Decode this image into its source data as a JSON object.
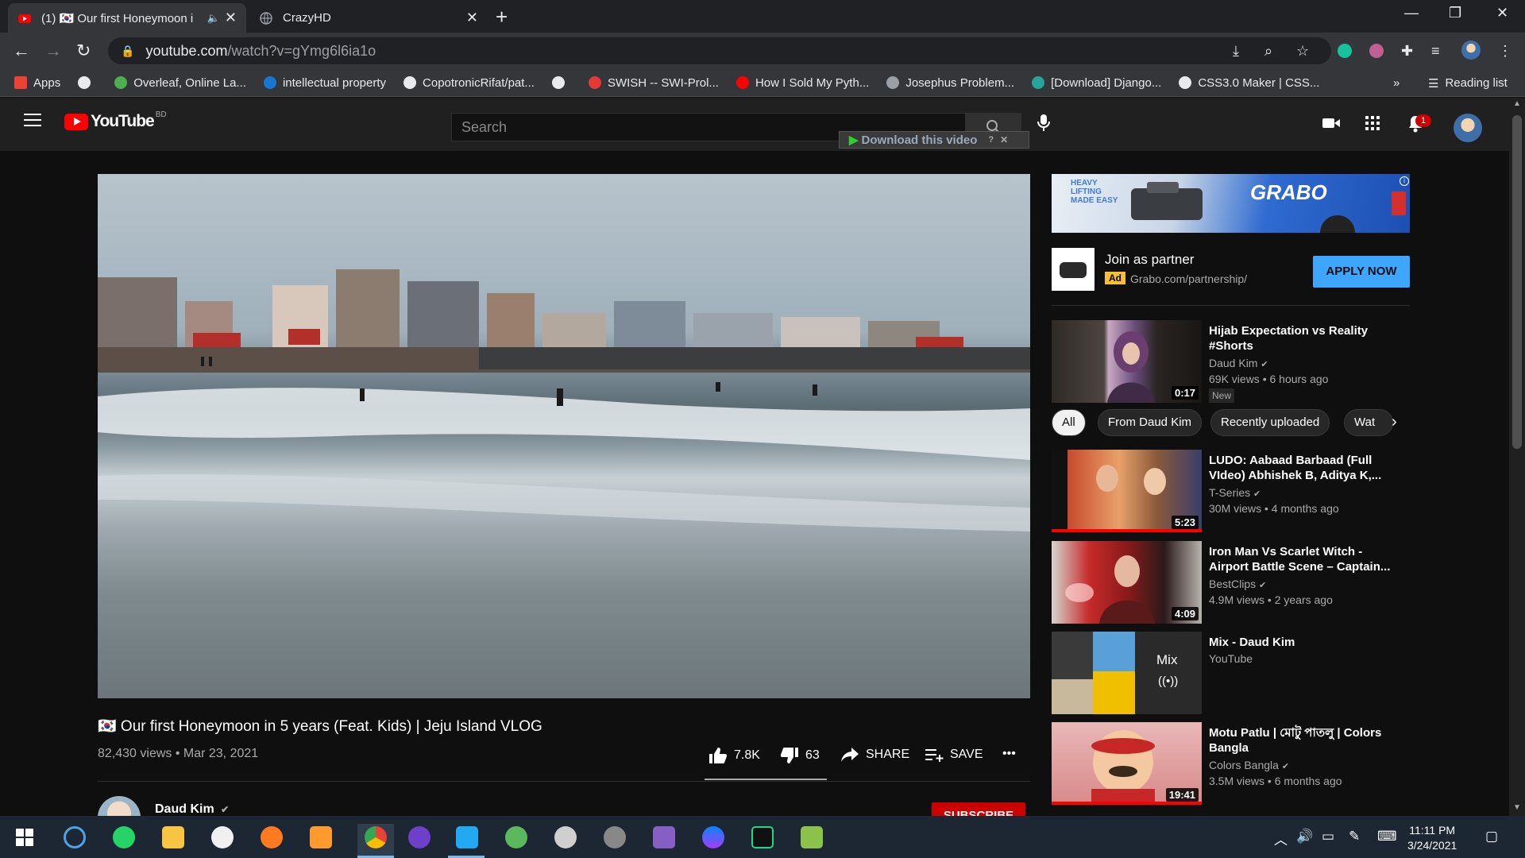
{
  "browser": {
    "tabs": [
      {
        "label": "(1) 🇰🇷 Our first Honeymoon i",
        "active": true
      },
      {
        "label": "CrazyHD",
        "active": false
      }
    ],
    "url_host": "youtube.com",
    "url_path": "/watch?v=gYmg6l6ia1o",
    "bookmarks": [
      {
        "label": "Apps",
        "color": "#ea4335"
      },
      {
        "label": "",
        "color": "#e8eaed"
      },
      {
        "label": "Overleaf, Online La...",
        "color": "#4caf50"
      },
      {
        "label": "intellectual property",
        "color": "#1976d2"
      },
      {
        "label": "CopotronicRifat/pat...",
        "color": "#e8eaed"
      },
      {
        "label": "",
        "color": "#e8eaed"
      },
      {
        "label": "SWISH -- SWI-Prol...",
        "color": "#e53935"
      },
      {
        "label": "How I Sold My Pyth...",
        "color": "#ff0000"
      },
      {
        "label": "Josephus Problem...",
        "color": "#9aa0a6"
      },
      {
        "label": "[Download] Django...",
        "color": "#26a69a"
      },
      {
        "label": "CSS3.0 Maker | CSS...",
        "color": "#e8eaed"
      }
    ],
    "more_label": "»",
    "reading_list": "Reading list"
  },
  "youtube": {
    "logo_text": "YouTube",
    "country": "BD",
    "search_placeholder": "Search",
    "download_banner": "Download this video",
    "notification_count": "1"
  },
  "video": {
    "title": "🇰🇷 Our first Honeymoon in 5 years (Feat. Kids) | Jeju Island VLOG",
    "views_date": "82,430 views • Mar 23, 2021",
    "likes": "7.8K",
    "dislikes": "63",
    "share": "SHARE",
    "save": "SAVE",
    "more": "•••",
    "channel": "Daud Kim",
    "subscribe": "SUBSCRIBE"
  },
  "ad": {
    "title": "Join as partner",
    "badge": "Ad",
    "url": "Grabo.com/partnership/",
    "cta": "APPLY NOW",
    "brand": "GRABO",
    "tagline": "HEAVY LIFTING MADE EASY"
  },
  "chips": [
    "All",
    "From Daud Kim",
    "Recently uploaded",
    "Wat"
  ],
  "recommendations": [
    {
      "title": "Hijab Expectation vs Reality #Shorts",
      "channel": "Daud Kim",
      "verified": true,
      "meta": "69K views • 6 hours ago",
      "duration": "0:17",
      "badge": "New"
    },
    {
      "title": "LUDO: Aabaad Barbaad (Full VIdeo) Abhishek B, Aditya K,...",
      "channel": "T-Series",
      "verified": true,
      "meta": "30M views • 4 months ago",
      "duration": "5:23"
    },
    {
      "title": "Iron Man Vs Scarlet Witch - Airport Battle Scene – Captain...",
      "channel": "BestClips",
      "verified": true,
      "meta": "4.9M views • 2 years ago",
      "duration": "4:09"
    },
    {
      "title": "Mix - Daud Kim",
      "channel": "YouTube",
      "verified": false,
      "meta": "",
      "duration": "Mix"
    },
    {
      "title": "Motu Patlu | মোটু পাতলু | Colors Bangla",
      "channel": "Colors Bangla",
      "verified": true,
      "meta": "3.5M views • 6 months ago",
      "duration": "19:41"
    }
  ],
  "taskbar": {
    "time": "11:11 PM",
    "date": "3/24/2021"
  }
}
